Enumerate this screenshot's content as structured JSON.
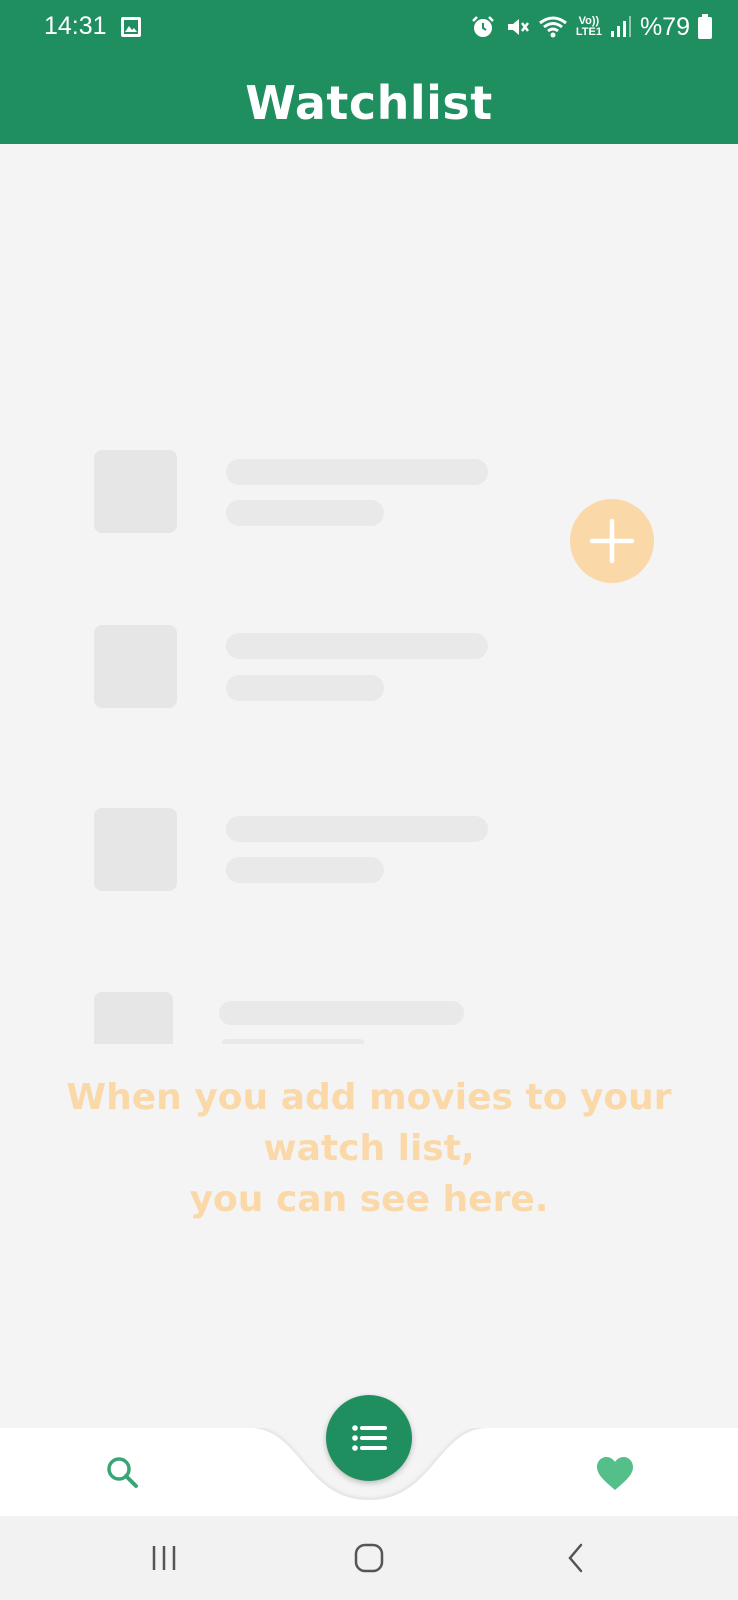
{
  "status_bar": {
    "time": "14:31",
    "battery_text": "%79",
    "network_label_top": "Vo))",
    "network_label_bottom": "LTE1",
    "icons": [
      "gallery-icon",
      "alarm-icon",
      "mute-icon",
      "wifi-icon",
      "signal-icon",
      "battery-icon"
    ]
  },
  "header": {
    "title": "Watchlist"
  },
  "empty_state": {
    "line1": "When you add movies to your watch list,",
    "line2": "you can see here."
  },
  "bottom_nav": {
    "items": [
      "search-icon",
      "list-icon",
      "heart-icon"
    ]
  },
  "system_nav": {
    "items": [
      "recents-icon",
      "home-icon",
      "back-icon"
    ]
  },
  "colors": {
    "primary": "#1f8f5f",
    "accent_light": "#fbd8a7",
    "background": "#f4f4f4",
    "skeleton": "#e6e6e6"
  }
}
